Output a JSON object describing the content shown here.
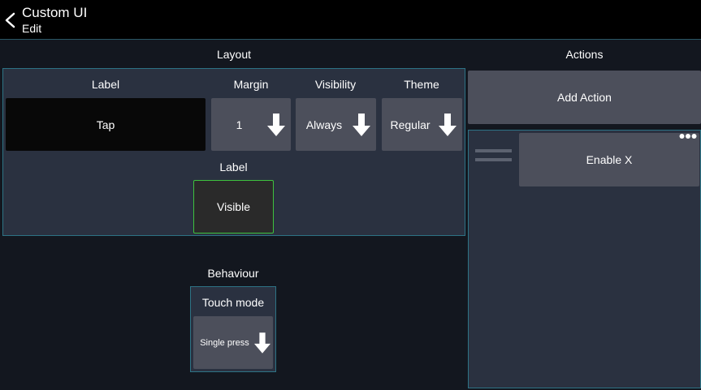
{
  "header": {
    "title": "Custom UI",
    "subtitle": "Edit",
    "back_icon": "chevron-left-icon"
  },
  "layout": {
    "title": "Layout",
    "columns": {
      "label": "Label",
      "margin": "Margin",
      "visibility": "Visibility",
      "theme": "Theme"
    },
    "label_value": "Tap",
    "margin_value": "1",
    "visibility_value": "Always",
    "theme_value": "Regular",
    "dropdown_icon": "arrow-down-icon",
    "label_visibility_title": "Label",
    "label_visibility_value": "Visible",
    "toggle_border_color": "#3ec23e"
  },
  "behaviour": {
    "title": "Behaviour",
    "touch_mode_label": "Touch mode",
    "touch_mode_value": "Single press"
  },
  "actions": {
    "title": "Actions",
    "add_label": "Add Action",
    "items": [
      {
        "label": "Enable X"
      }
    ],
    "more_icon": "more-dots-icon",
    "drag_icon": "drag-handle-icon"
  },
  "colors": {
    "background": "#13171f",
    "header": "#000000",
    "panel": "#2a3140",
    "panel_border": "#2d7385",
    "button": "#4c4f5b"
  }
}
